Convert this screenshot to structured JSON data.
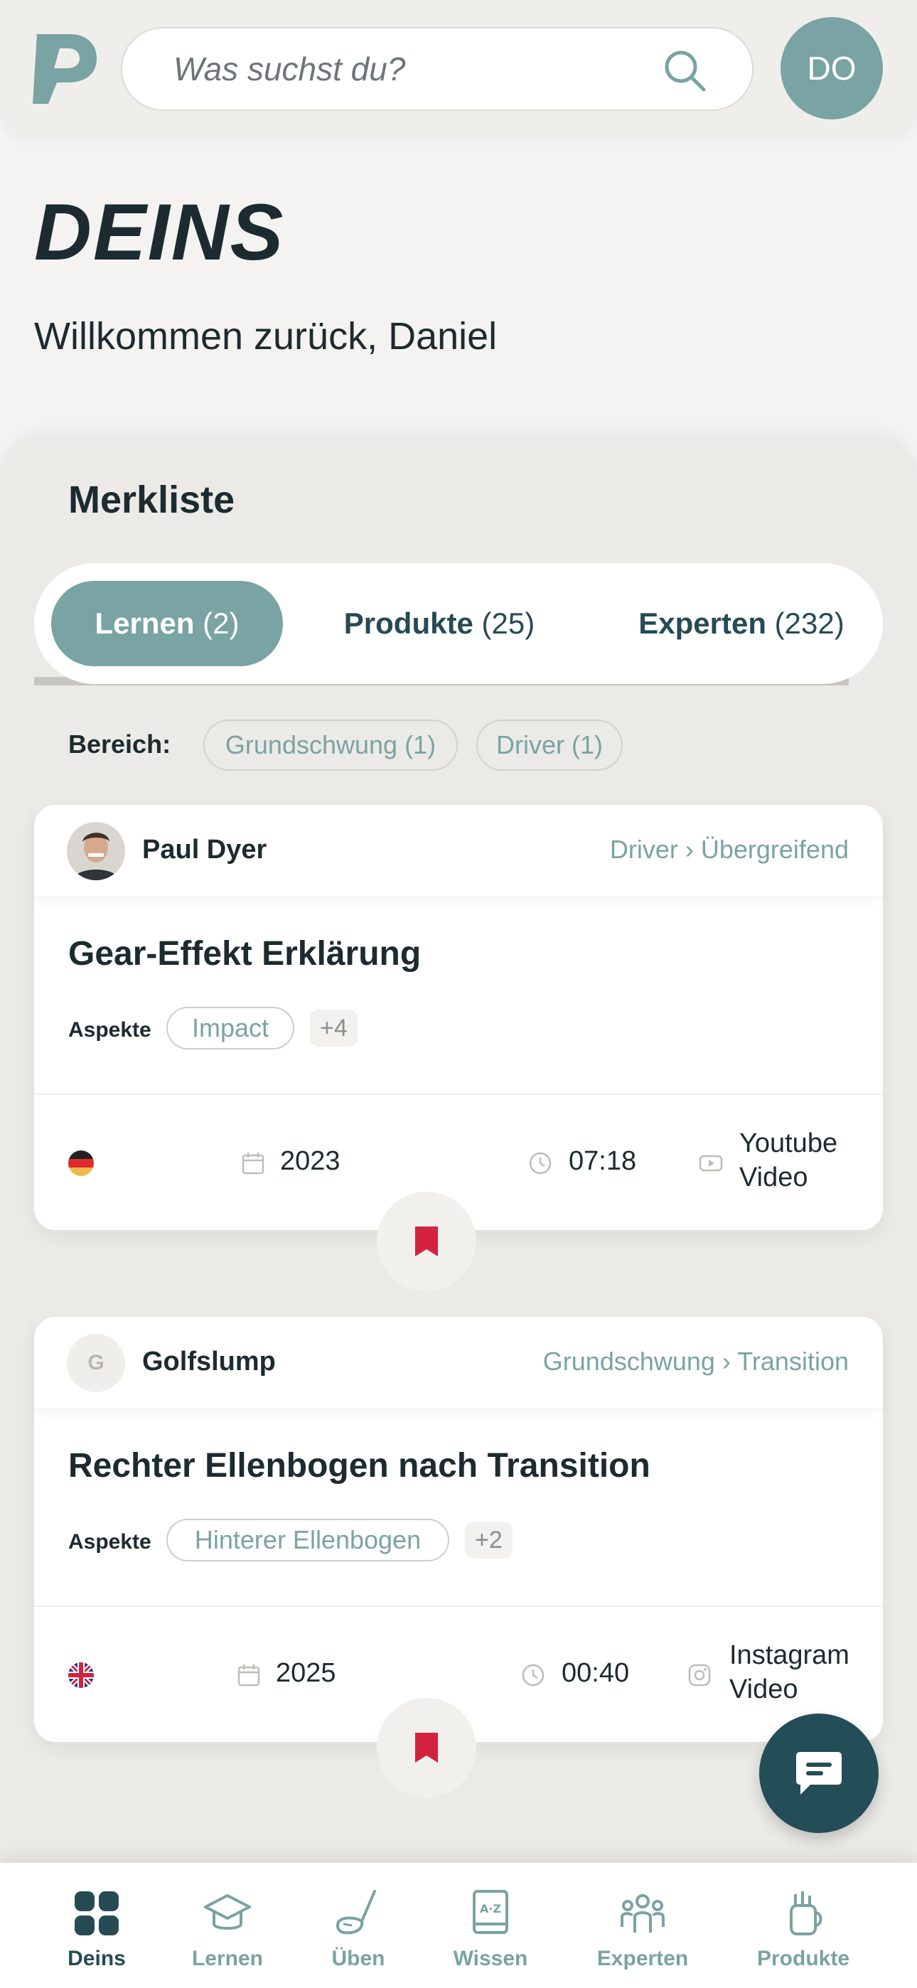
{
  "header": {
    "search_placeholder": "Was suchst du?",
    "user_initials": "DO"
  },
  "page": {
    "title": "DEINS",
    "welcome": "Willkommen zurück, Daniel"
  },
  "watchlist": {
    "title": "Merkliste",
    "tabs": [
      {
        "label": "Lernen",
        "count": "(2)",
        "active": true
      },
      {
        "label": "Produkte",
        "count": "(25)",
        "active": false
      },
      {
        "label": "Experten",
        "count": "(232)",
        "active": false
      }
    ],
    "filter_label": "Bereich:",
    "filters": [
      "Grundschwung (1)",
      "Driver (1)"
    ]
  },
  "cards": [
    {
      "author": "Paul Dyer",
      "breadcrumb": "Driver › Übergreifend",
      "title": "Gear-Effekt Erklärung",
      "aspects_label": "Aspekte",
      "aspect": "Impact",
      "aspect_more": "+4",
      "language": "de",
      "year": "2023",
      "duration": "07:18",
      "source_line1": "Youtube",
      "source_line2": "Video"
    },
    {
      "author": "Golfslump",
      "author_initial": "G",
      "breadcrumb": "Grundschwung › Transition",
      "title": "Rechter Ellenbogen nach Transition",
      "aspects_label": "Aspekte",
      "aspect": "Hinterer Ellenbogen",
      "aspect_more": "+2",
      "language": "en",
      "year": "2025",
      "duration": "00:40",
      "source_line1": "Instagram",
      "source_line2": "Video"
    }
  ],
  "bottom_nav": [
    {
      "label": "Deins",
      "icon": "grid-icon",
      "active": true
    },
    {
      "label": "Lernen",
      "icon": "graduation-cap-icon",
      "active": false
    },
    {
      "label": "Üben",
      "icon": "golf-club-icon",
      "active": false
    },
    {
      "label": "Wissen",
      "icon": "book-az-icon",
      "active": false
    },
    {
      "label": "Experten",
      "icon": "people-icon",
      "active": false
    },
    {
      "label": "Produkte",
      "icon": "golf-bag-icon",
      "active": false
    }
  ],
  "colors": {
    "accent": "#7aa3a3",
    "dark": "#264b55",
    "bookmark": "#d3223e",
    "background": "#f4f3f1"
  }
}
